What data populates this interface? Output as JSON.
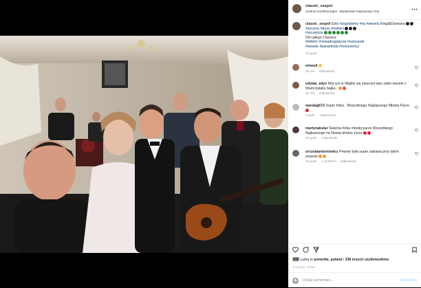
{
  "post": {
    "username": "classic_zespol",
    "location": "Centrum Konferencyjno - Bankietowe Księżycowy Czar",
    "caption_prefix": "",
    "caption_text1": "Dziś ",
    "tag_zagralismy": "#zagraliśmy",
    "tag_na": "#na",
    "tag_weselu": "#weselu",
    "caption_text2": " Kingi&Damiana",
    "tag_zyczmy": "#życzmy",
    "tag_duzo": "#dużo",
    "tag_milosci": "#miłości",
    "tag_szczescia": "#szczęścia",
    "caption_text3": "Od całego Classica",
    "tags_line": "#miłość #nowadrogażycia #szacunek",
    "tags_line2": "#wesele #paramłoda #nowożeńcy",
    "time": "12 godz."
  },
  "comments": [
    {
      "username": "emwu6",
      "text": "",
      "time": "35 min",
      "reply": "Odpowiedz"
    },
    {
      "username": "edytaa_edys",
      "text": "Mój syn w Wigilie się zaręczył więc takie wesele z Wami byłaby bajka..",
      "time": "32 min",
      "reply": "Odpowiedz"
    },
    {
      "username": "wandag672",
      "text": "Super fotka . Wszystkiego Najlepszego Młodej Parze",
      "time": "3 godz.",
      "reply": "Odpowiedz"
    },
    {
      "username": "martynakular",
      "text": "Świetna fotka  młodej parze Wszystkiego Najlepszego na Nowej drodze życia",
      "time": "10 godz.",
      "reply": "Odpowiedz"
    },
    {
      "username": "urszulaantoniewicz",
      "text": "Pewnie była super zabawa przy takim zespole",
      "time": "12 godz.",
      "likes": "2 polubień",
      "reply": "Odpowiedz"
    }
  ],
  "likes_text_prefix": "Lubią to ",
  "likes_user": "pnmedia_poland",
  "likes_text_mid": " i ",
  "likes_others": "338 innych użytkowników",
  "date": "12 GODZ. TEMU",
  "add_comment_placeholder": "Dodaj komentarz...",
  "post_button": "Opublikuj",
  "colors": {
    "link": "#00376b",
    "heart_red": "#ed4956",
    "muted": "#8e8e8e"
  },
  "icons": [
    "heart-icon",
    "comment-icon",
    "share-icon",
    "bookmark-icon",
    "more-icon",
    "emoji-icon"
  ]
}
